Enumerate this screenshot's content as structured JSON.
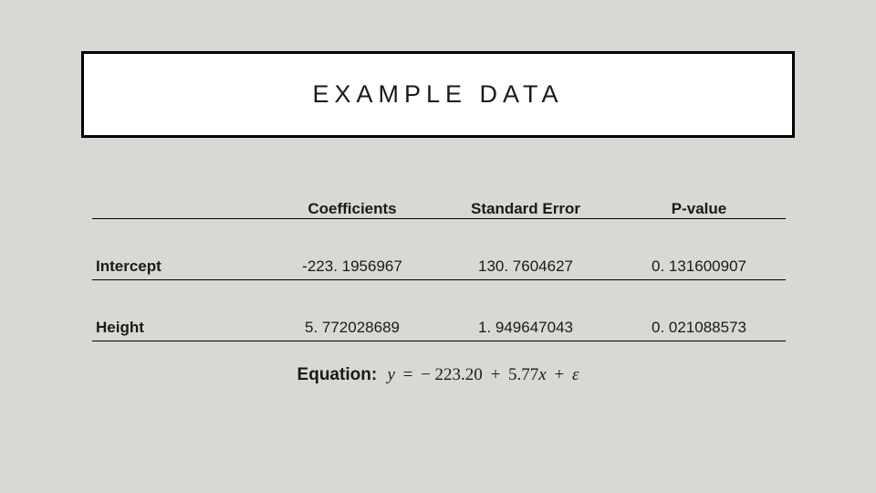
{
  "title": "EXAMPLE DATA",
  "table": {
    "headers": {
      "lab": "",
      "coefficients": "Coefficients",
      "stderr": "Standard Error",
      "pvalue": "P-value"
    },
    "rows": [
      {
        "label": "Intercept",
        "coefficients": "-223. 1956967",
        "stderr": "130. 7604627",
        "pvalue": "0. 131600907"
      },
      {
        "label": "Height",
        "coefficients": "5. 772028689",
        "stderr": "1. 949647043",
        "pvalue": "0. 021088573"
      }
    ]
  },
  "equation": {
    "label": "Equation:",
    "y": "y",
    "eq": "=",
    "c0": "− 223.20",
    "plus": "+",
    "c1": "5.77",
    "x": "x",
    "plus2": "+",
    "eps": "ε"
  },
  "chart_data": {
    "type": "table",
    "title": "EXAMPLE DATA",
    "columns": [
      "",
      "Coefficients",
      "Standard Error",
      "P-value"
    ],
    "rows": [
      [
        "Intercept",
        -223.1956967,
        130.7604627,
        0.131600907
      ],
      [
        "Height",
        5.772028689,
        1.949647043,
        0.021088573
      ]
    ],
    "equation": "y = -223.20 + 5.77 x + ε"
  }
}
